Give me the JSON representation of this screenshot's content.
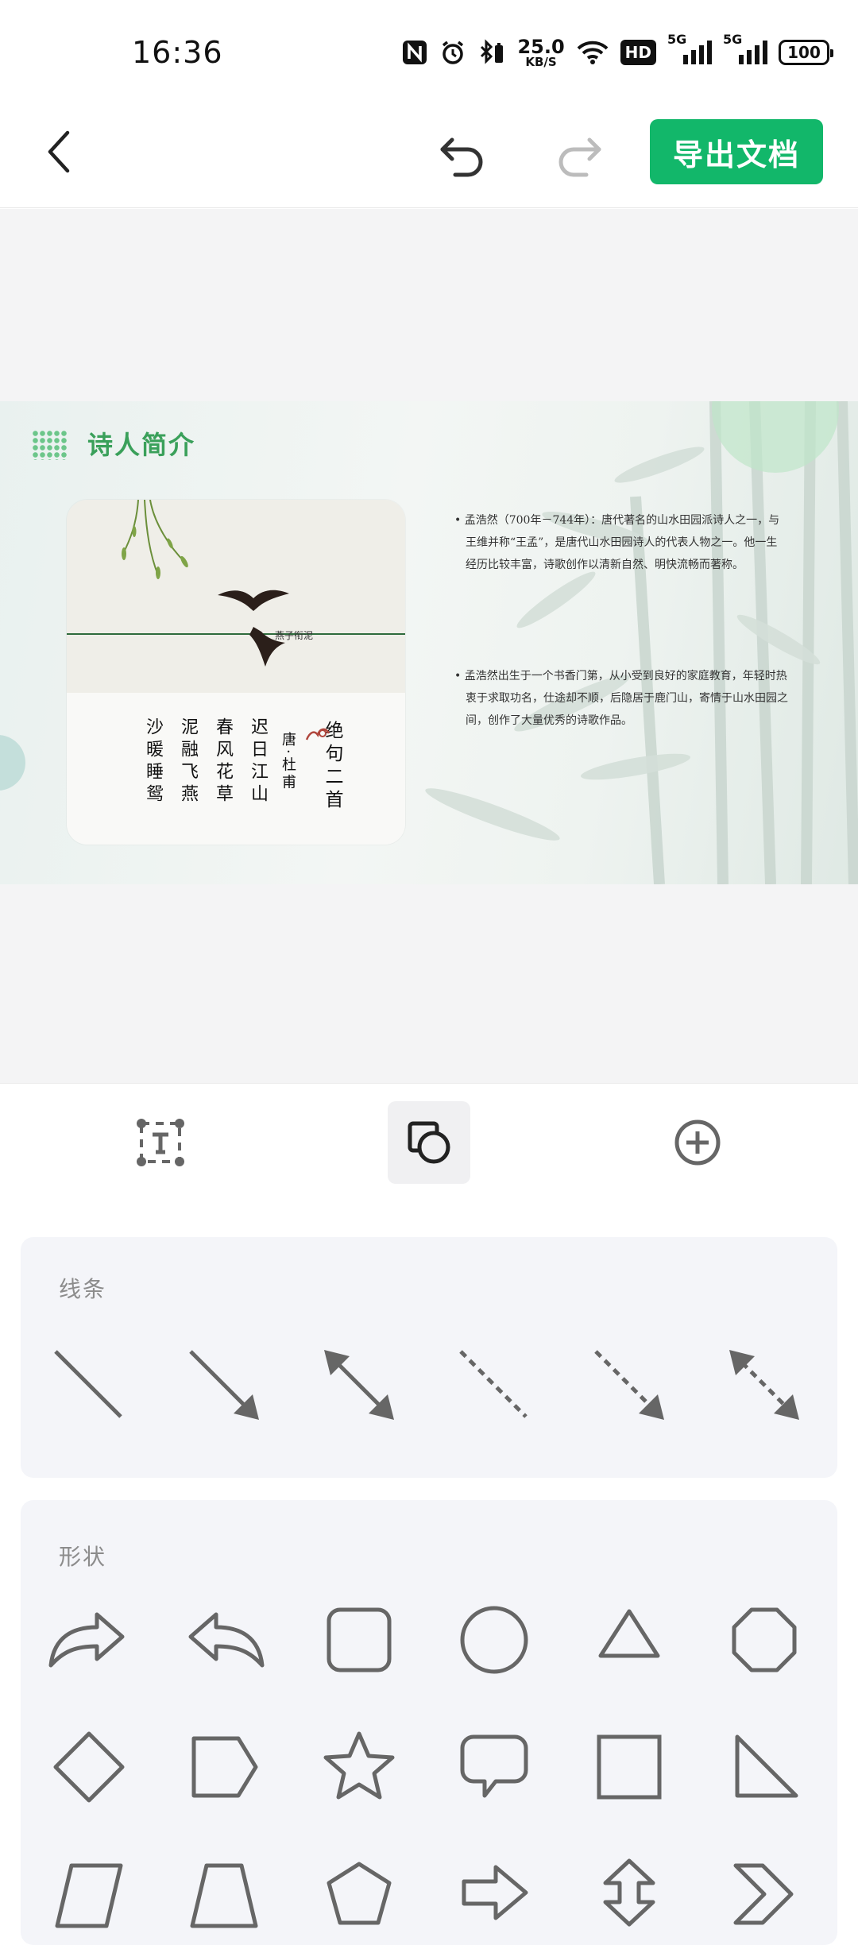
{
  "status": {
    "time": "16:36",
    "net_speed_value": "25.0",
    "net_speed_unit": "KB/S",
    "hd_label": "HD",
    "network1": "5G",
    "network2": "5G",
    "battery": "100"
  },
  "toolbar": {
    "export_label": "导出文档"
  },
  "slide": {
    "title": "诗人简介",
    "poem_title": "绝句二首",
    "poem_author": "唐·杜甫",
    "poem_lines": [
      "迟日江山",
      "春风花草",
      "泥融飞燕",
      "沙暖睡鸳"
    ],
    "swallow_caption": "燕子衔泥",
    "bullet1": "孟浩然（700年－744年）：唐代著名的山水田园派诗人之一，与王维并称“王孟”，是唐代山水田园诗人的代表人物之一。他一生经历比较丰富，诗歌创作以清新自然、明快流畅而著称。",
    "bullet2": "孟浩然出生于一个书香门第，从小受到良好的家庭教育，年轻时热衷于求取功名，仕途却不顺，后隐居于鹿门山，寄情于山水田园之间，创作了大量优秀的诗歌作品。"
  },
  "tabs": [
    {
      "name": "text-tab"
    },
    {
      "name": "shape-tab",
      "active": true
    },
    {
      "name": "insert-tab"
    }
  ],
  "panels": {
    "lines_title": "线条",
    "shapes_title": "形状"
  },
  "colors": {
    "accent": "#12b76a",
    "slide_title": "#3aa05a",
    "icon": "#666666"
  }
}
